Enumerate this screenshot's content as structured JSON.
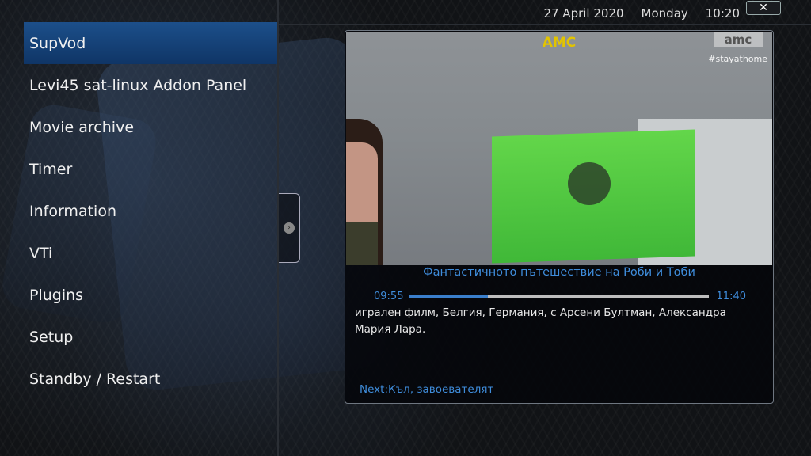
{
  "header": {
    "date": "27 April 2020",
    "weekday": "Monday",
    "time": "10:20",
    "close_icon": "close-icon"
  },
  "menu": {
    "items": [
      {
        "label": "SupVod",
        "selected": true
      },
      {
        "label": "Levi45 sat-linux Addon Panel",
        "selected": false
      },
      {
        "label": "Movie archive",
        "selected": false
      },
      {
        "label": "Timer",
        "selected": false
      },
      {
        "label": "Information",
        "selected": false
      },
      {
        "label": "VTi",
        "selected": false
      },
      {
        "label": "Plugins",
        "selected": false
      },
      {
        "label": "Setup",
        "selected": false
      },
      {
        "label": "Standby / Restart",
        "selected": false
      }
    ]
  },
  "preview": {
    "channel_name": "AMC",
    "channel_bug": "amc",
    "hashtag": "#stayathome",
    "program_title": "Фантастичното пътешествие на Роби и Тоби",
    "start_time": "09:55",
    "end_time": "11:40",
    "progress": 0.26,
    "description": "игрален филм, Белгия, Германия, с Арсени Бултман, Александра Мария Лара.",
    "next": "Next:Къл, завоевателят"
  },
  "colors": {
    "accent_blue": "#3f8ddc",
    "selection": "#1c4f8a",
    "channel_yellow": "#e2c400"
  }
}
